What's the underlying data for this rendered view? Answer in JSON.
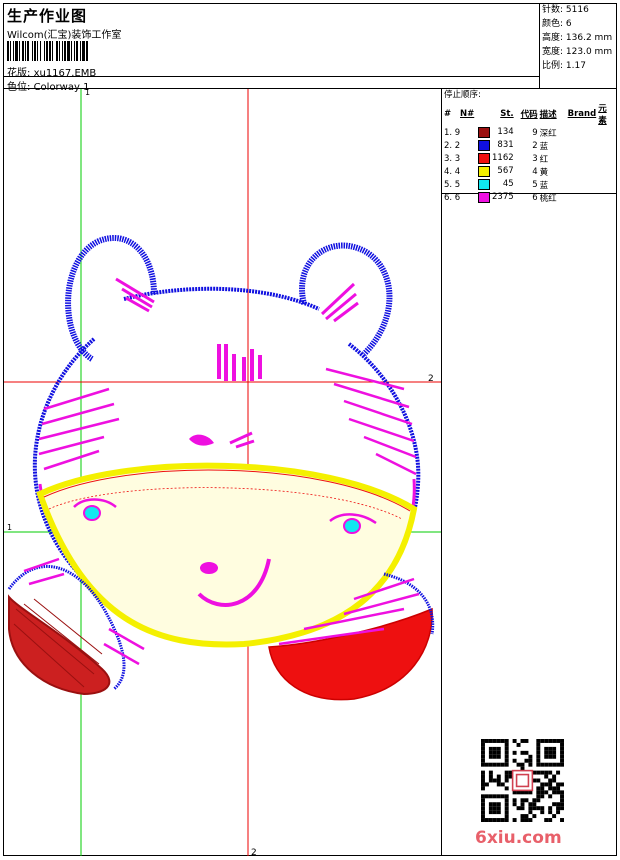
{
  "header": {
    "title": "生产作业图",
    "company": "Wilcom(汇宝)装饰工作室",
    "design_label": "花版:",
    "design_value": "xu1167.EMB",
    "color_label": "色位:",
    "color_value": "Colorway 1"
  },
  "stats": [
    {
      "label": "针数:",
      "value": "5116"
    },
    {
      "label": "颜色:",
      "value": "6"
    },
    {
      "label": "高度:",
      "value": "136.2 mm"
    },
    {
      "label": "宽度:",
      "value": "123.0 mm"
    },
    {
      "label": "比例:",
      "value": "1.17"
    }
  ],
  "guides": {
    "v1": "1",
    "h2": "2",
    "h1": "1",
    "v2": "2"
  },
  "stop_sequence": {
    "title": "停止顺序:",
    "headers": {
      "hash": "#",
      "n": "N#",
      "st": "St.",
      "code": "代码",
      "desc": "描述",
      "brand": "Brand",
      "element": "元素"
    },
    "rows": [
      {
        "idx": "1. 9",
        "color": "#9a1010",
        "st": "134",
        "code": "9",
        "desc": "深红"
      },
      {
        "idx": "2. 2",
        "color": "#1010e0",
        "st": "831",
        "code": "2",
        "desc": "蓝"
      },
      {
        "idx": "3. 3",
        "color": "#ee1010",
        "st": "1162",
        "code": "3",
        "desc": "红"
      },
      {
        "idx": "4. 4",
        "color": "#f4f000",
        "st": "567",
        "code": "4",
        "desc": "黄"
      },
      {
        "idx": "5. 5",
        "color": "#10e8f0",
        "st": "45",
        "code": "5",
        "desc": "蓝"
      },
      {
        "idx": "6. 6",
        "color": "#ee10e0",
        "st": "2375",
        "code": "6",
        "desc": "桃红"
      }
    ]
  },
  "brand": {
    "text": "6xiu.com"
  },
  "colors": {
    "blue": "#1010e0",
    "magenta": "#ee10e0",
    "yellow": "#f4f000",
    "red": "#ee1010",
    "darkred": "#9a1010",
    "cyan": "#10e8f0",
    "guide_green": "#00cc00",
    "guide_red": "#ee0000"
  }
}
